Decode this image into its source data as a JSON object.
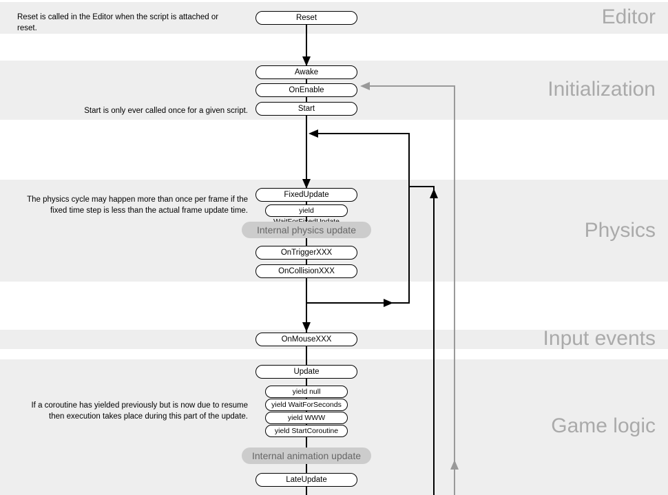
{
  "sections": {
    "editor": {
      "title": "Editor",
      "desc": "Reset is called in the Editor when the script is attached or reset."
    },
    "init": {
      "title": "Initialization",
      "desc": "Start is only ever called once for a given script."
    },
    "physics": {
      "title": "Physics",
      "desc": "The physics cycle may happen more than once per frame if the fixed time step is less than the actual frame update time."
    },
    "input": {
      "title": "Input events"
    },
    "game": {
      "title": "Game logic",
      "desc": "If a coroutine has yielded previously but is now due to resume then execution takes place during this part of the update."
    }
  },
  "nodes": {
    "reset": "Reset",
    "awake": "Awake",
    "onenable": "OnEnable",
    "start": "Start",
    "fixedupdate": "FixedUpdate",
    "yieldfixed": "yield WaitForFixedUpdate",
    "internalphys": "Internal physics update",
    "ontrigger": "OnTriggerXXX",
    "oncollision": "OnCollisionXXX",
    "onmouse": "OnMouseXXX",
    "update": "Update",
    "yieldnull": "yield null",
    "yieldseconds": "yield WaitForSeconds",
    "yieldwww": "yield WWW",
    "yieldstart": "yield StartCoroutine",
    "internalanim": "Internal animation update",
    "lateupdate": "LateUpdate"
  }
}
